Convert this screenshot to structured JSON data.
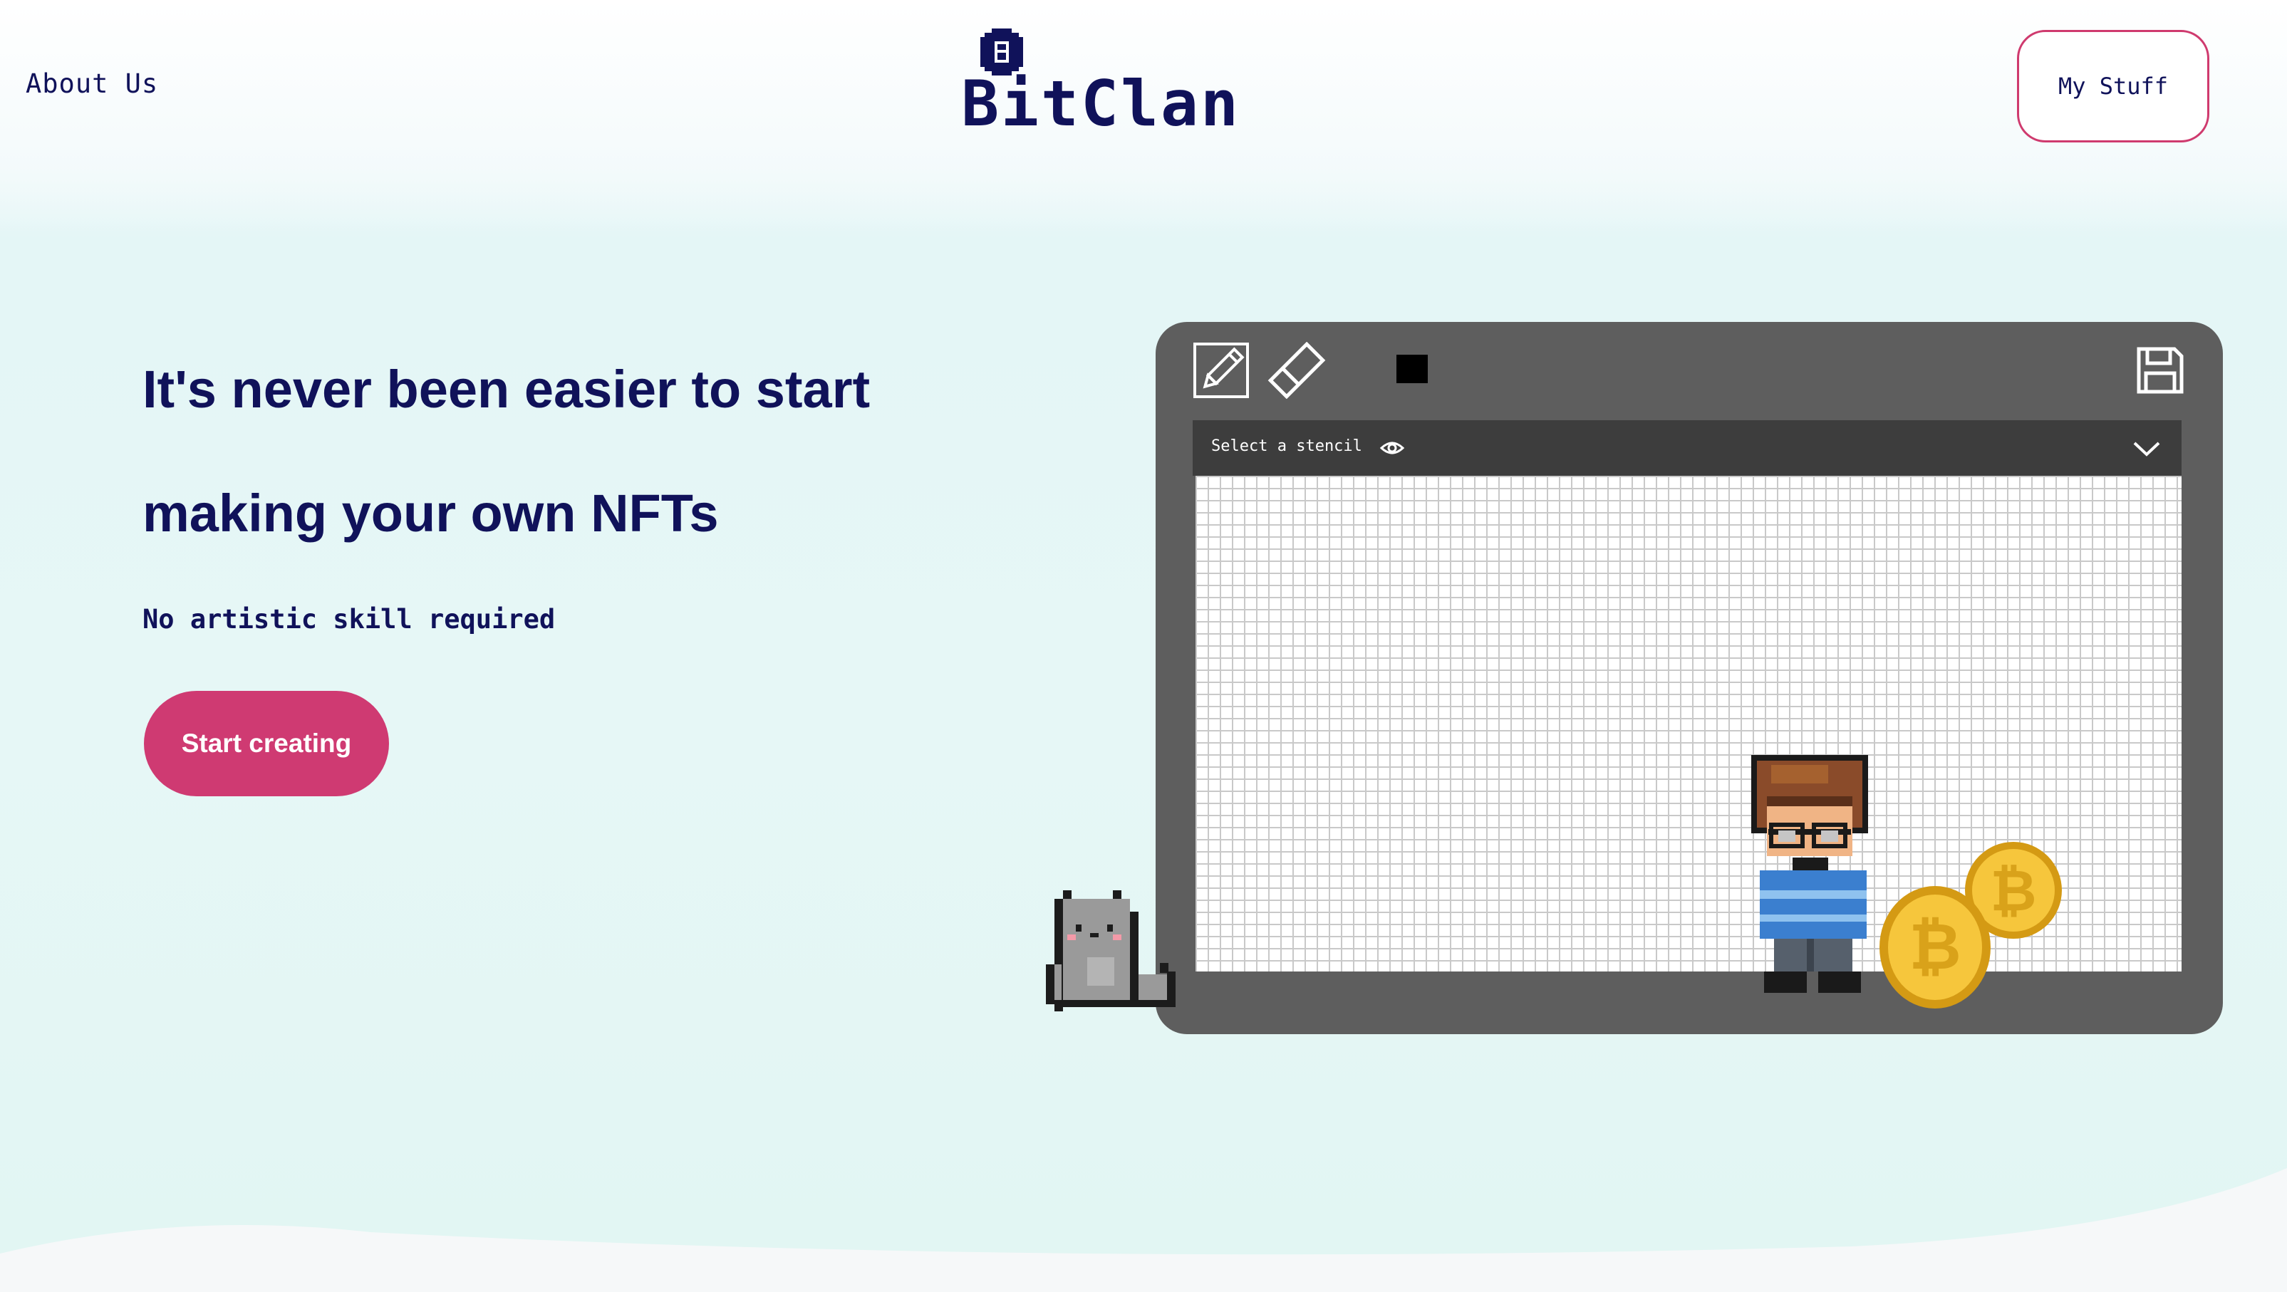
{
  "nav": {
    "about_label": "About Us",
    "logo_text": "BitClan",
    "my_stuff_label": "My Stuff"
  },
  "hero": {
    "headline": "It's never been easier to start making your own NFTs",
    "subheadline": "No artistic skill required",
    "cta_label": "Start creating"
  },
  "editor": {
    "tools": [
      "pencil-icon",
      "eraser-icon",
      "color-swatch",
      "save-icon"
    ],
    "selected_color": "#000000",
    "stencil_placeholder": "Select a stencil"
  },
  "colors": {
    "brand_navy": "#10125a",
    "accent_pink": "#cf3a72",
    "editor_frame": "#5e5e5e",
    "stencil_bar": "#3d3d3d",
    "background_mint": "#e4f6f6"
  }
}
